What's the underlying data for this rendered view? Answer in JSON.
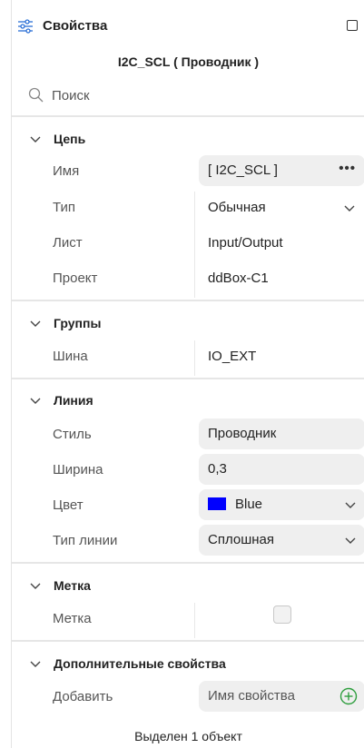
{
  "header": {
    "title": "Свойства",
    "icon": "sliders-icon"
  },
  "object_title": "I2C_SCL ( Проводник )",
  "search": {
    "placeholder": "Поиск"
  },
  "sections": {
    "circuit": {
      "title": "Цепь",
      "name": {
        "label": "Имя",
        "value": "[ I2C_SCL ]",
        "menu": "•••"
      },
      "type": {
        "label": "Тип",
        "value": "Обычная"
      },
      "sheet": {
        "label": "Лист",
        "value": "Input/Output"
      },
      "project": {
        "label": "Проект",
        "value": "ddBox-C1"
      }
    },
    "groups": {
      "title": "Группы",
      "bus": {
        "label": "Шина",
        "value": "IO_EXT"
      }
    },
    "line": {
      "title": "Линия",
      "style": {
        "label": "Стиль",
        "value": "Проводник"
      },
      "width": {
        "label": "Ширина",
        "value": "0,3"
      },
      "color": {
        "label": "Цвет",
        "value": "Blue",
        "swatch": "#0000ff"
      },
      "line_type": {
        "label": "Тип линии",
        "value": "Сплошная"
      }
    },
    "mark": {
      "title": "Метка",
      "mark": {
        "label": "Метка",
        "checked": false
      }
    },
    "extra": {
      "title": "Дополнительные свойства",
      "add": {
        "label": "Добавить",
        "placeholder": "Имя свойства"
      }
    }
  },
  "footer": {
    "status": "Выделен 1 объект"
  },
  "colors": {
    "accent_plus": "#2e9e3e",
    "swatch_blue": "#0000ff",
    "separator": "#e6e6e6"
  }
}
